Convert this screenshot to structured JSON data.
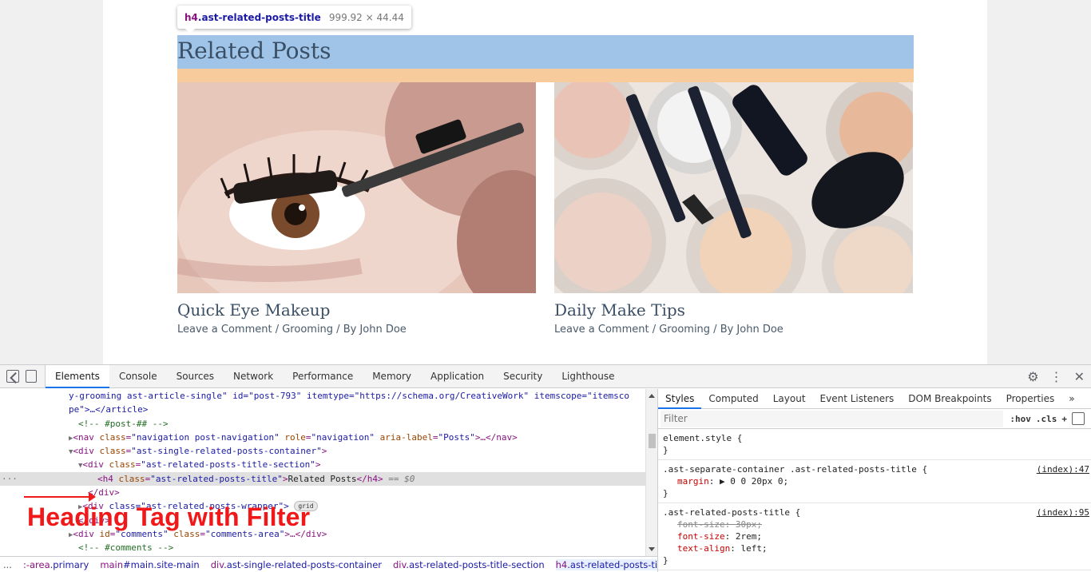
{
  "page": {
    "related_title": "Related Posts",
    "tooltip": {
      "tag": "h4",
      "cls": ".ast-related-posts-title",
      "dims": "999.92 × 44.44"
    },
    "posts": [
      {
        "title": "Quick Eye Makeup",
        "meta": "Leave a Comment / Grooming / By John Doe",
        "image": "mascara-eye-photo"
      },
      {
        "title": "Daily Make Tips",
        "meta": "Leave a Comment / Grooming / By John Doe",
        "image": "makeup-brushes-powder-photo"
      }
    ]
  },
  "devtools": {
    "tabs": [
      "Elements",
      "Console",
      "Sources",
      "Network",
      "Performance",
      "Memory",
      "Application",
      "Security",
      "Lighthouse"
    ],
    "active_tab": "Elements",
    "annotation": "Heading Tag with Filter",
    "breadcrumbs": {
      "lead": "...",
      "items": [
        {
          "main": ":-area",
          "cls": ".primary"
        },
        {
          "main": "main",
          "cls": "#main.site-main"
        },
        {
          "main": "div",
          "cls": ".ast-single-related-posts-container"
        },
        {
          "main": "div",
          "cls": ".ast-related-posts-title-section"
        },
        {
          "main": "h4",
          "cls": ".ast-related-posts-title"
        }
      ],
      "more": "..."
    },
    "styles": {
      "tabs": [
        "Styles",
        "Computed",
        "Layout",
        "Event Listeners",
        "DOM Breakpoints",
        "Properties",
        "»"
      ],
      "active_tab": "Styles",
      "filter_placeholder": "Filter",
      "hov": ":hov",
      "cls": ".cls",
      "plus": "+",
      "rules": {
        "r1_selector": "element.style {",
        "r1_close": "}",
        "r2_selector": ".ast-separate-container .ast-related-posts-title {",
        "r2_src": "(index):47",
        "r2_prop": "margin",
        "r2_val": "▶ 0 0 20px 0;",
        "r2_close": "}",
        "r3_selector": ".ast-related-posts-title {",
        "r3_src": "(index):95",
        "r3_p1": "font-size",
        "r3_v1": "30px;",
        "r3_p2": "font-size",
        "r3_v2": "2rem;",
        "r3_p3": "text-align",
        "r3_v3": "left;",
        "r3_close": "}"
      }
    },
    "dom": {
      "l1_a": "y-grooming ast-article-single\" id=\"post-793\" itemtype=\"https://schema.org/CreativeWork\" itemscope=\"itemsco",
      "l1_b": "pe\">…</article>",
      "l2": "<!-- #post-## -->",
      "l3_tag": "nav",
      "l3_c1": "class",
      "l3_v1": "\"navigation post-navigation\"",
      "l3_c2": "role",
      "l3_v2": "\"navigation\"",
      "l3_c3": "aria-label",
      "l3_v3": "\"Posts\"",
      "l3_tail": ">…</nav>",
      "l4_v": "\"ast-single-related-posts-container\"",
      "l5_v": "\"ast-related-posts-title-section\"",
      "l6_v": "\"ast-related-posts-title\"",
      "l6_text": "Related Posts",
      "l6_dollar": "== $0",
      "l7": "</div>",
      "l8_a": "<div",
      "l8_b": "class=\"ast-related-posts-wrapper\">",
      "l8_pill": "grid",
      "l9": "</div>",
      "l10_c1": "id",
      "l10_v1": "\"comments\"",
      "l10_v2": "\"comments-area\"",
      "l10_tail": ">…</div>",
      "l11": "<!-- #comments -->"
    }
  }
}
